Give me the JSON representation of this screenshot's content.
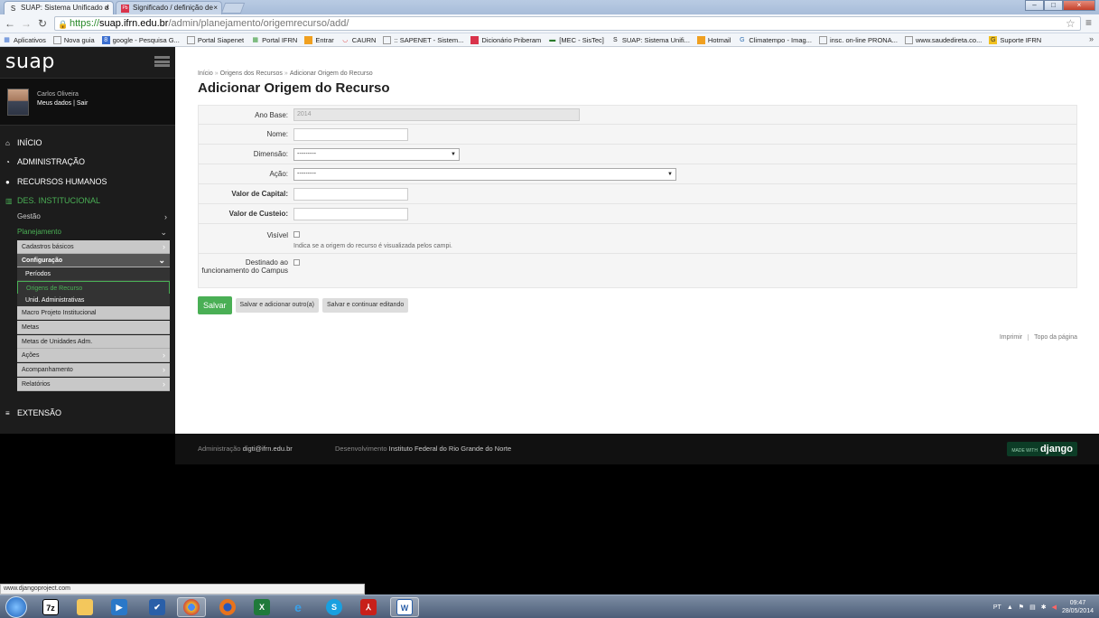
{
  "browser": {
    "tabs": [
      {
        "label": "SUAP: Sistema Unificado d",
        "icon": "suap-icon"
      },
      {
        "label": "Significado / definição de",
        "icon": "priberam-icon"
      }
    ],
    "url_scheme": "https://",
    "url_host": "suap.ifrn.edu.br",
    "url_path": "/admin/planejamento/origemrecurso/add/",
    "bookmarks": [
      "Aplicativos",
      "Nova guia",
      "google - Pesquisa G...",
      "Portal Siapenet",
      "Portal IFRN",
      "Entrar",
      "CAURN",
      ":: SAPENET - Sistem...",
      "Dicionário Priberam",
      "[MEC - SisTec]",
      "SUAP: Sistema Unifi...",
      "Hotmail",
      "Climatempo - Imag...",
      "insc. on-line PRONA...",
      "www.saudedireta.co...",
      "Suporte IFRN"
    ]
  },
  "sidebar": {
    "logo": "suap",
    "user_name": "Carlos Oliveira",
    "user_links": "Meus dados | Sair",
    "main_items": [
      "INÍCIO",
      "ADMINISTRAÇÃO",
      "RECURSOS HUMANOS",
      "DES. INSTITUCIONAL",
      "EXTENSÃO"
    ],
    "sub_gestao": "Gestão",
    "sub_planejamento": "Planejamento",
    "cadastros_basicos": "Cadastros básicos",
    "configuracao": "Configuração",
    "config_items": [
      "Períodos",
      "Origens de Recurso",
      "Unid. Administrativas"
    ],
    "other_items": [
      "Macro Projeto Institucional",
      "Metas",
      "Metas de Unidades Adm.",
      "Ações",
      "Acompanhamento",
      "Relatórios"
    ]
  },
  "main": {
    "breadcrumb": [
      "Início",
      "Origens dos Recursos",
      "Adicionar Origem do Recurso"
    ],
    "title": "Adicionar Origem do Recurso",
    "fields": {
      "ano_base_label": "Ano Base:",
      "ano_base_value": "2014",
      "nome_label": "Nome:",
      "dimensao_label": "Dimensão:",
      "dimensao_value": "---------",
      "acao_label": "Ação:",
      "acao_value": "---------",
      "valor_capital_label": "Valor de Capital:",
      "valor_custeio_label": "Valor de Custeio:",
      "visivel_label": "Visível",
      "visivel_help": "Indica se a origem do recurso é visualizada pelos campi.",
      "destinado_label": "Destinado ao funcionamento do Campus"
    },
    "buttons": {
      "save": "Salvar",
      "save_add": "Salvar e adicionar outro(a)",
      "save_continue": "Salvar e continuar editando"
    },
    "print_link": "Imprimir",
    "top_link": "Topo da página"
  },
  "footer": {
    "admin_label": "Administração",
    "admin_email": "digti@ifrn.edu.br",
    "dev_label": "Desenvolvimento",
    "dev_value": "Instituto Federal do Rio Grande do Norte",
    "badge_small": "MADE WITH",
    "badge_big": "django"
  },
  "statusbar": "www.djangoproject.com",
  "taskbar": {
    "lang": "PT",
    "time": "09:47",
    "date": "28/05/2014"
  },
  "colors": {
    "accent_green": "#4aaf55",
    "sidebar_bg": "#1c1c1c"
  }
}
